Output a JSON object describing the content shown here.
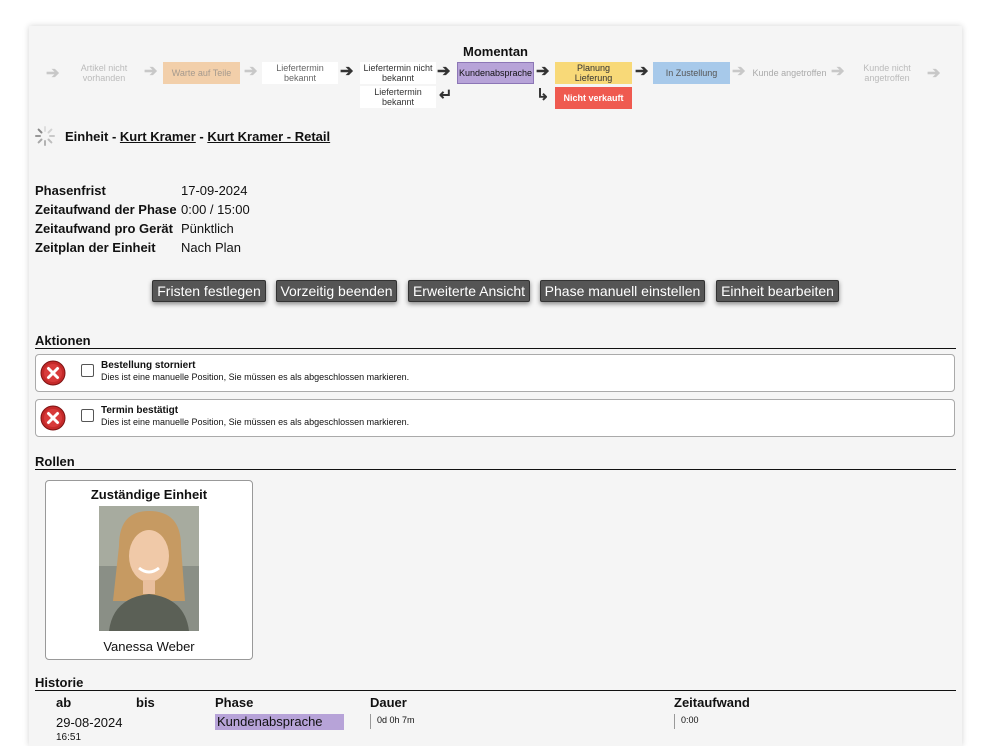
{
  "workflow": {
    "momentan_label": "Momentan",
    "stages": {
      "artikel_nicht_vorhanden": "Artikel nicht vorhanden",
      "warte_auf_teile": "Warte auf Teile",
      "liefertermin_bekannt": "Liefertermin bekannt",
      "liefertermin_nicht_bekannt": "Liefertermin nicht bekannt",
      "liefertermin_bekannt_2": "Liefertermin bekannt",
      "kundenabsprache": "Kundenabsprache",
      "nicht_verkauft": "Nicht verkauft",
      "planung_lieferung": "Planung Lieferung",
      "in_zustellung": "In Zustellung",
      "kunde_angetroffen": "Kunde angetroffen",
      "kunde_nicht_angetroffen": "Kunde nicht angetroffen"
    },
    "colors": {
      "warte": "#f2cfaa",
      "kundenabsprache": "#b7a3d8",
      "nicht_verkauft": "#ef5a50",
      "planung": "#f8d978",
      "zustellung": "#a7c9ea"
    }
  },
  "header": {
    "prefix": "Einheit",
    "sep1": " - ",
    "link1": "Kurt Kramer",
    "sep2": " - ",
    "link2": "Kurt Kramer - Retail"
  },
  "info": {
    "phasenfrist_label": "Phasenfrist",
    "phasenfrist_value": "17-09-2024",
    "zeitaufwand_phase_label": "Zeitaufwand der Phase",
    "zeitaufwand_phase_value": "0:00 / 15:00",
    "zeitaufwand_geraet_label": "Zeitaufwand pro Gerät",
    "zeitaufwand_geraet_value": "Pünktlich",
    "zeitplan_label": "Zeitplan der Einheit",
    "zeitplan_value": "Nach Plan"
  },
  "buttons": {
    "fristen": "Fristen festlegen",
    "vorzeitig": "Vorzeitig beenden",
    "erweitert": "Erweiterte Ansicht",
    "phase_manuell": "Phase manuell einstellen",
    "einheit_bearbeiten": "Einheit bearbeiten"
  },
  "aktionen": {
    "title": "Aktionen",
    "items": [
      {
        "title": "Bestellung storniert",
        "desc": "Dies ist eine manuelle Position, Sie müssen es als abgeschlossen markieren."
      },
      {
        "title": "Termin bestätigt",
        "desc": "Dies ist eine manuelle Position, Sie müssen es als abgeschlossen markieren."
      }
    ]
  },
  "rollen": {
    "title": "Rollen",
    "card_title": "Zuständige Einheit",
    "name": "Vanessa Weber"
  },
  "historie": {
    "title": "Historie",
    "headers": {
      "ab": "ab",
      "bis": "bis",
      "phase": "Phase",
      "dauer": "Dauer",
      "zeitaufwand": "Zeitaufwand"
    },
    "row": {
      "ab_date": "29-08-2024",
      "ab_time": "16:51",
      "phase": "Kundenabsprache",
      "dauer": "0d 0h 7m",
      "zeitaufwand": "0:00"
    }
  }
}
